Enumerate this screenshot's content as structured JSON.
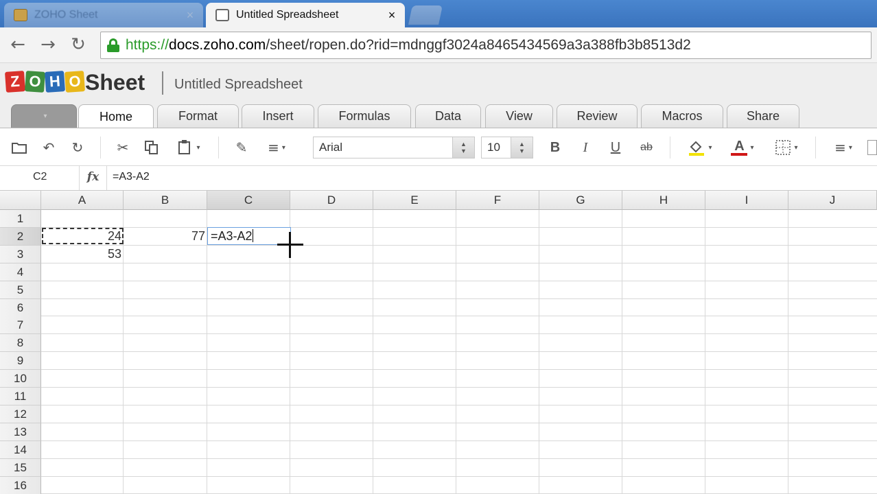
{
  "browser": {
    "tabs": [
      {
        "title": "ZOHO Sheet",
        "active": false
      },
      {
        "title": "Untitled Spreadsheet",
        "active": true
      }
    ],
    "close_glyph": "×",
    "url_protocol": "https://",
    "url_host": "docs.zoho.com",
    "url_path": "/sheet/ropen.do?rid=mdnggf3024a8465434569a3a388fb3b8513d2",
    "nav": {
      "back": "←",
      "forward": "→",
      "reload": "↻"
    }
  },
  "app": {
    "logo_letters": [
      "Z",
      "O",
      "H",
      "O"
    ],
    "product": "Sheet",
    "document_title": "Untitled Spreadsheet",
    "menu_label": "",
    "ribbon_tabs": [
      "Home",
      "Format",
      "Insert",
      "Formulas",
      "Data",
      "View",
      "Review",
      "Macros",
      "Share"
    ],
    "active_tab": "Home"
  },
  "toolbar": {
    "font_name": "Arial",
    "font_size": "10",
    "bold": "B",
    "italic": "I",
    "underline": "U",
    "strike": "ab",
    "font_color_letter": "A",
    "colors": {
      "fill_highlight": "#f2e200",
      "font_color": "#d01818"
    }
  },
  "formula_bar": {
    "name_box": "C2",
    "fx_label": "fx",
    "formula": "=A3-A2"
  },
  "grid": {
    "columns": [
      "A",
      "B",
      "C",
      "D",
      "E",
      "F",
      "G",
      "H",
      "I",
      "J"
    ],
    "selected_column": "C",
    "rows": [
      "1",
      "2",
      "3",
      "4",
      "5",
      "6",
      "7",
      "8",
      "9",
      "10",
      "11",
      "12",
      "13",
      "14",
      "15",
      "16"
    ],
    "selected_row": "2",
    "cells": {
      "A2": "24",
      "B2": "77",
      "A3": "53",
      "C2": "=A3-A2"
    },
    "active_cell": "C2",
    "copy_range": "A2"
  }
}
